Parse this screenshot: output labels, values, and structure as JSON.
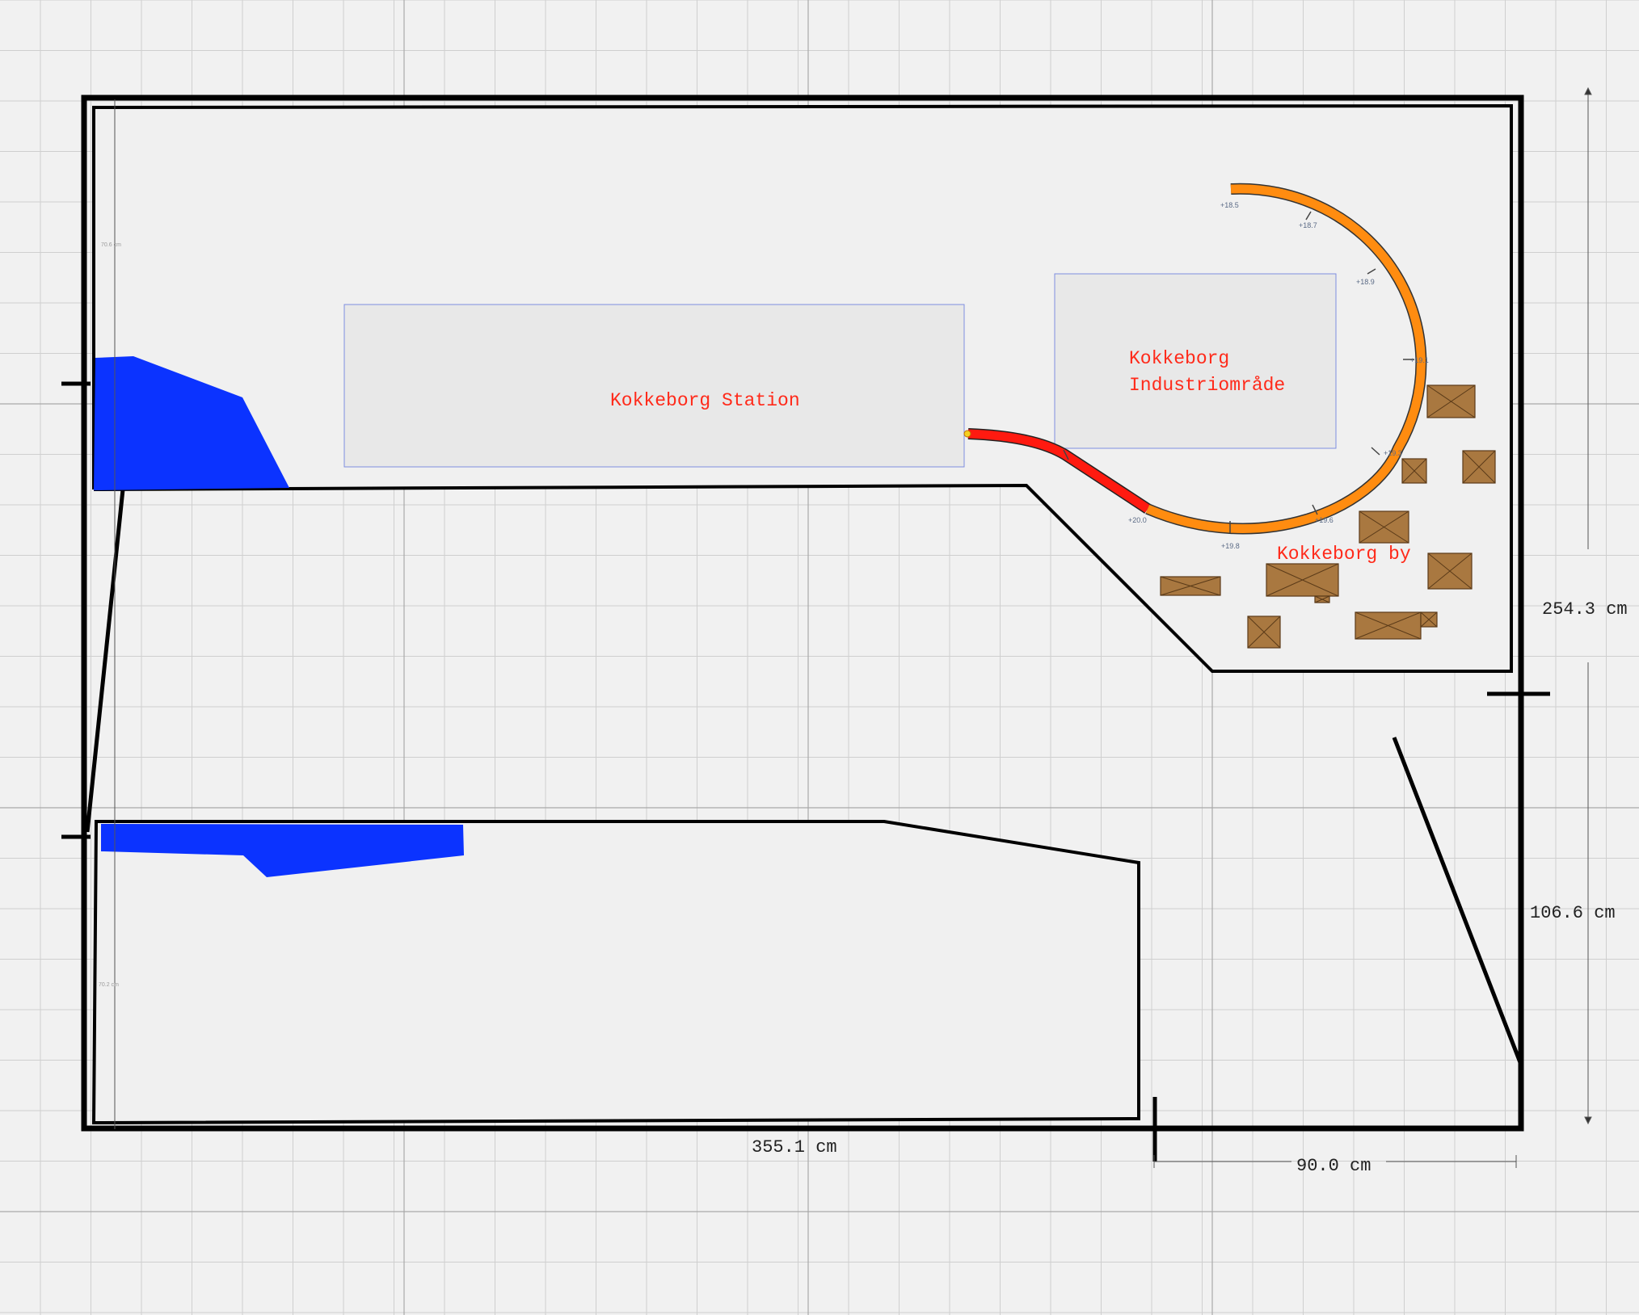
{
  "labels": {
    "station": "Kokkeborg Station",
    "industry_line1": "Kokkeborg",
    "industry_line2": "Industriområde",
    "town": "Kokkeborg by"
  },
  "dimensions": {
    "bottom_left": "355.1 cm",
    "bottom_right": "90.0 cm",
    "right_upper": "254.3 cm",
    "right_lower": "106.6 cm",
    "inner_top": "70.6 cm",
    "inner_bottom": "70.2 cm"
  },
  "elevations": [
    "+18.5",
    "+18.7",
    "+18.9",
    "+19.1",
    "+19.3",
    "+19.6",
    "+19.8",
    "+20.0"
  ],
  "colors": {
    "background": "#f1f1f1",
    "grid": "#cfcfcf",
    "grid_major": "#a9a9a9",
    "water": "#0b33ff",
    "track_orange": "#ff8c10",
    "track_red": "#ff1a10",
    "building": "#a97840",
    "label_red": "#ff2a1a"
  }
}
